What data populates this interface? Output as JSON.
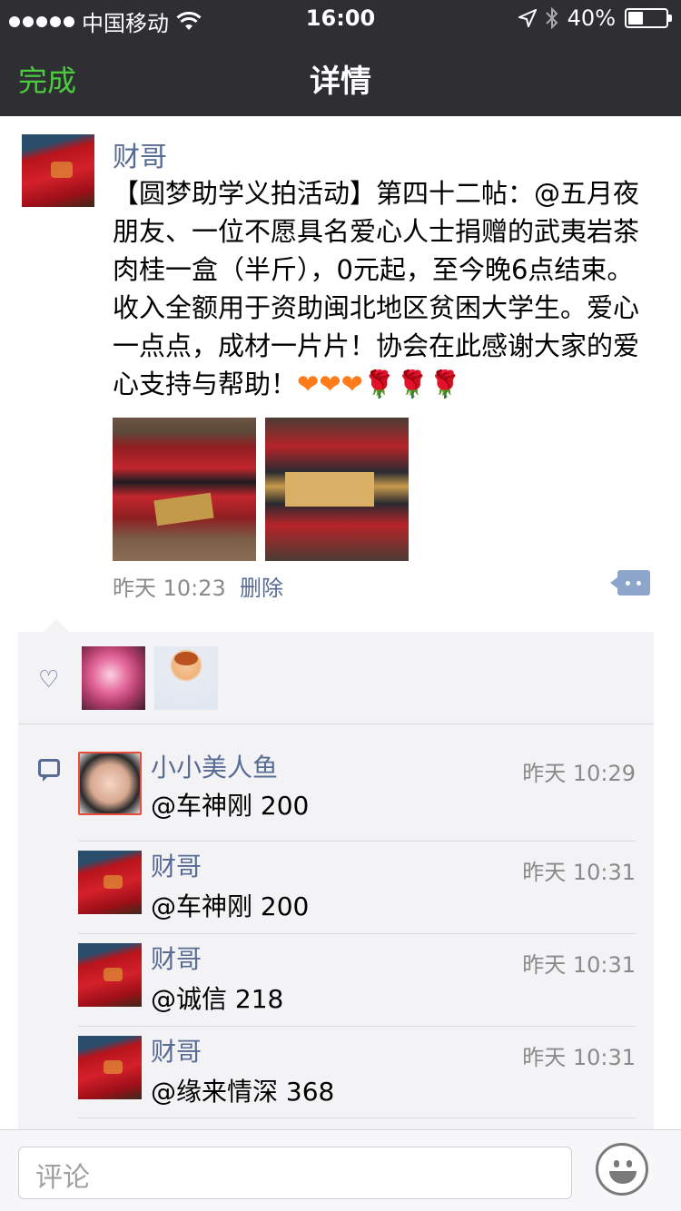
{
  "status_bar": {
    "carrier": "中国移动",
    "time": "16:00",
    "battery": "40%",
    "battery_level": 0.4
  },
  "nav": {
    "done_label": "完成",
    "title": "详情"
  },
  "post": {
    "author": "财哥",
    "text": "【圆梦助学义拍活动】第四十二帖：@五月夜朋友、一位不愿具名爱心人士捐赠的武夷岩茶肉桂一盒（半斤），0元起，至今晚6点结束。收入全额用于资助闽北地区贫困大学生。爱心一点点，成材一片片！协会在此感谢大家的爱心支持与帮助！",
    "emoji_hearts": "❤❤❤",
    "emoji_roses": "🌹🌹🌹",
    "photos": [
      "photo-1",
      "photo-2"
    ],
    "time": "昨天 10:23",
    "delete_label": "删除"
  },
  "likes": {
    "icon": "heart-icon",
    "avatars": [
      "flower-avatar",
      "cartoon-avatar"
    ]
  },
  "comments": [
    {
      "name": "小小美人鱼",
      "text": "@车神刚 200",
      "time": "昨天 10:29"
    },
    {
      "name": "财哥",
      "text": "@车神刚 200",
      "time": "昨天 10:31"
    },
    {
      "name": "财哥",
      "text": "@诚信 218",
      "time": "昨天 10:31"
    },
    {
      "name": "财哥",
      "text": "@缘来情深 368",
      "time": "昨天 10:31"
    }
  ],
  "input": {
    "placeholder": "评论"
  }
}
